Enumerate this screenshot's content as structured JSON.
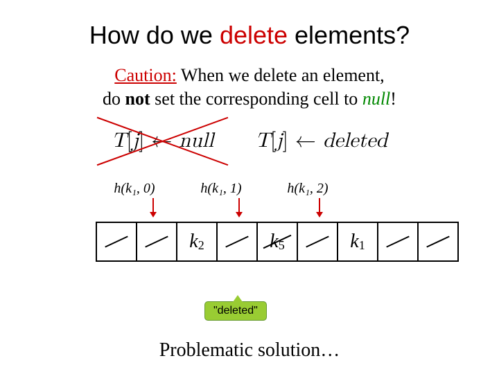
{
  "title": {
    "part1": "How do we ",
    "highlight": "delete",
    "part2": " elements?"
  },
  "caution": {
    "label": "Caution:",
    "line1_rest": " When we delete an element,",
    "line2_pre": "do ",
    "line2_bold": "not",
    "line2_mid": " set the corresponding cell to ",
    "line2_null": "null",
    "line2_end": "!"
  },
  "formula": {
    "left": "T[j] ← null",
    "right": "T[j] ← deleted"
  },
  "hash_labels": [
    "h(k₁, 0)",
    "h(k₁, 1)",
    "h(k₁, 2)"
  ],
  "cells": {
    "k2_base": "k",
    "k2_sub": "2",
    "k5_base": "k",
    "k5_sub": "5",
    "k1_base": "k",
    "k1_sub": "1"
  },
  "callout_text": "\"deleted\"",
  "footer": "Problematic solution…"
}
